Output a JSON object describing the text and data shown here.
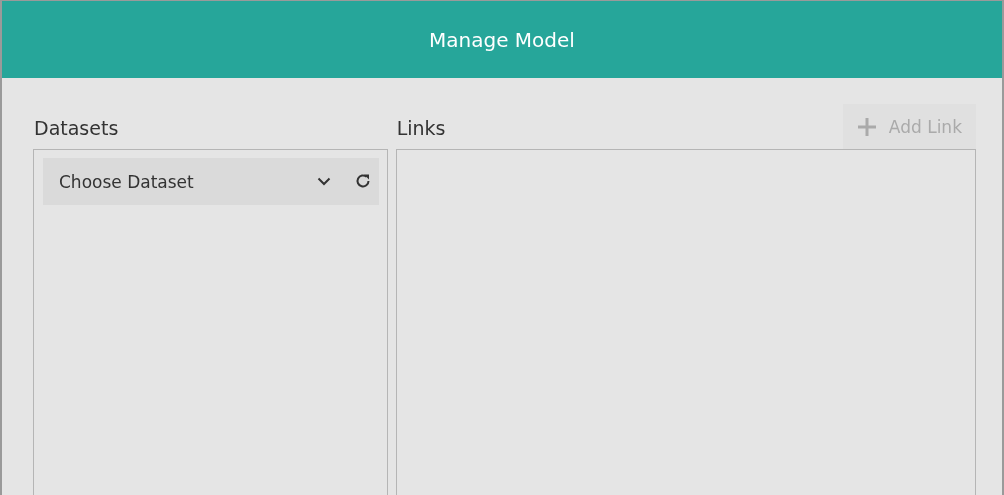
{
  "dialog": {
    "title": "Manage Model"
  },
  "datasets": {
    "heading": "Datasets",
    "dropdown": {
      "placeholder": "Choose Dataset"
    }
  },
  "links": {
    "heading": "Links",
    "add_button": {
      "label": "Add Link",
      "disabled": true
    }
  }
}
